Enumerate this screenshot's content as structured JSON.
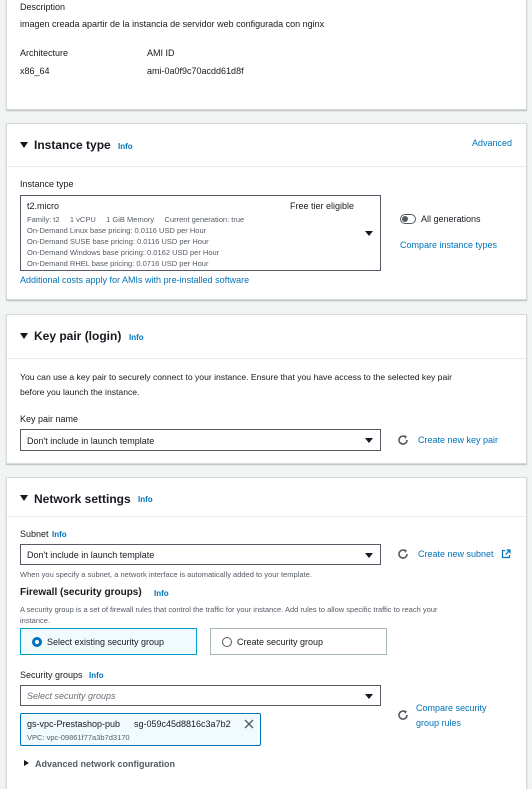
{
  "ami": {
    "description_label": "Description",
    "description_value": "imagen creada apartir de la instancia de servidor web configurada con nginx",
    "architecture_label": "Architecture",
    "architecture_value": "x86_64",
    "ami_id_label": "AMI ID",
    "ami_id_value": "ami-0a0f9c70acdd61d8f"
  },
  "instance_type": {
    "title": "Instance type",
    "info": "Info",
    "advanced": "Advanced",
    "field_label": "Instance type",
    "selected": {
      "name": "t2.micro",
      "badge": "Free tier eligible",
      "specs": "Family: t2     1 vCPU     1 GiB Memory     Current generation: true",
      "pricing": [
        "On-Demand Linux base pricing: 0.0116 USD per Hour",
        "On-Demand SUSE base pricing: 0.0116 USD per Hour",
        "On-Demand Windows base pricing: 0.0162 USD per Hour",
        "On-Demand RHEL base pricing: 0.0716 USD per Hour"
      ]
    },
    "all_generations": "All generations",
    "compare": "Compare instance types",
    "additional_costs": "Additional costs apply for AMIs with pre-installed software"
  },
  "key_pair": {
    "title": "Key pair (login)",
    "info": "Info",
    "description_line1": "You can use a key pair to securely connect to your instance. Ensure that you have access to the selected key pair",
    "description_line2": "before you launch the instance.",
    "field_label": "Key pair name",
    "selected": "Don't include in launch template",
    "create_link": "Create new key pair"
  },
  "network": {
    "title": "Network settings",
    "info": "Info",
    "subnet_label": "Subnet",
    "subnet_info": "Info",
    "subnet_selected": "Don't include in launch template",
    "create_subnet": "Create new subnet",
    "subnet_hint": "When you specify a subnet, a network interface is automatically added to your template.",
    "firewall_title": "Firewall (security groups)",
    "firewall_info": "Info",
    "firewall_desc_line1": "A security group is a set of firewall rules that control the traffic for your instance. Add rules to allow specific traffic to reach your",
    "firewall_desc_line2": "instance.",
    "option_existing": "Select existing security group",
    "option_create": "Create security group",
    "sg_label": "Security groups",
    "sg_info": "Info",
    "sg_placeholder": "Select security groups",
    "compare_rules_line1": "Compare security",
    "compare_rules_line2": "group rules",
    "token_name": "gs-vpc-Prestashop-pub",
    "token_id": "sg-059c45d8816c3a7b2",
    "token_vpc": "VPC: vpc-09861f77a3b7d3170",
    "advanced_config": "Advanced network configuration"
  }
}
